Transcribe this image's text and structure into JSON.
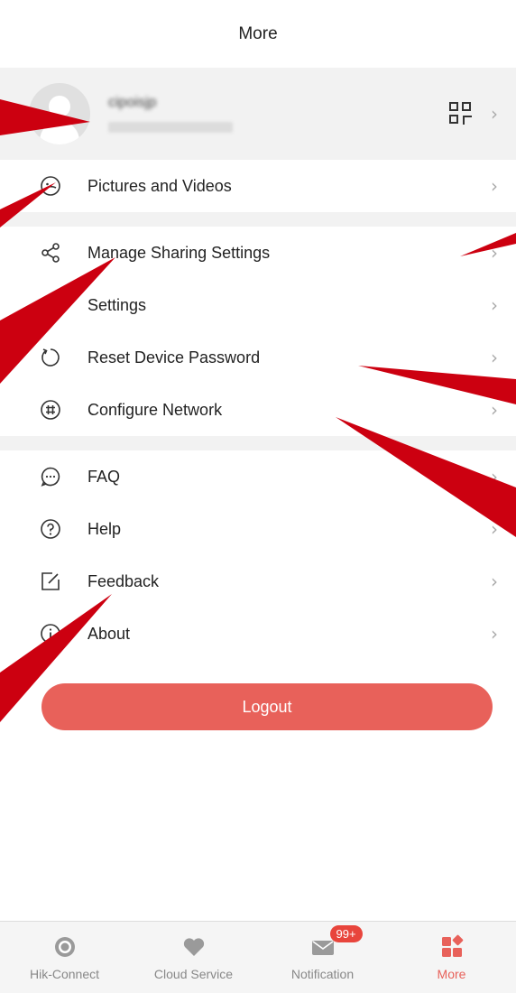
{
  "header": {
    "title": "More"
  },
  "profile": {
    "name": "cipoisjp",
    "chevron": "›",
    "qr_icon": "qr-code-icon"
  },
  "group1": [
    {
      "label": "Pictures and Videos",
      "icon": "photo-icon"
    }
  ],
  "group2": [
    {
      "label": "Manage Sharing Settings",
      "icon": "share-icon"
    },
    {
      "label": "Settings",
      "icon": "gear-icon"
    },
    {
      "label": "Reset Device Password",
      "icon": "reset-icon"
    },
    {
      "label": "Configure Network",
      "icon": "network-icon"
    }
  ],
  "group3": [
    {
      "label": "FAQ",
      "icon": "faq-icon"
    },
    {
      "label": "Help",
      "icon": "help-icon"
    },
    {
      "label": "Feedback",
      "icon": "feedback-icon"
    },
    {
      "label": "About",
      "icon": "about-icon"
    }
  ],
  "chevron": "›",
  "logout": {
    "label": "Logout"
  },
  "tabbar": {
    "tabs": [
      {
        "label": "Hik-Connect",
        "icon": "camera-icon"
      },
      {
        "label": "Cloud Service",
        "icon": "heart-icon"
      },
      {
        "label": "Notification",
        "icon": "mail-icon",
        "badge": "99+"
      },
      {
        "label": "More",
        "icon": "grid-icon"
      }
    ]
  },
  "colors": {
    "accent": "#e8615a",
    "annotation": "#cc0010"
  }
}
